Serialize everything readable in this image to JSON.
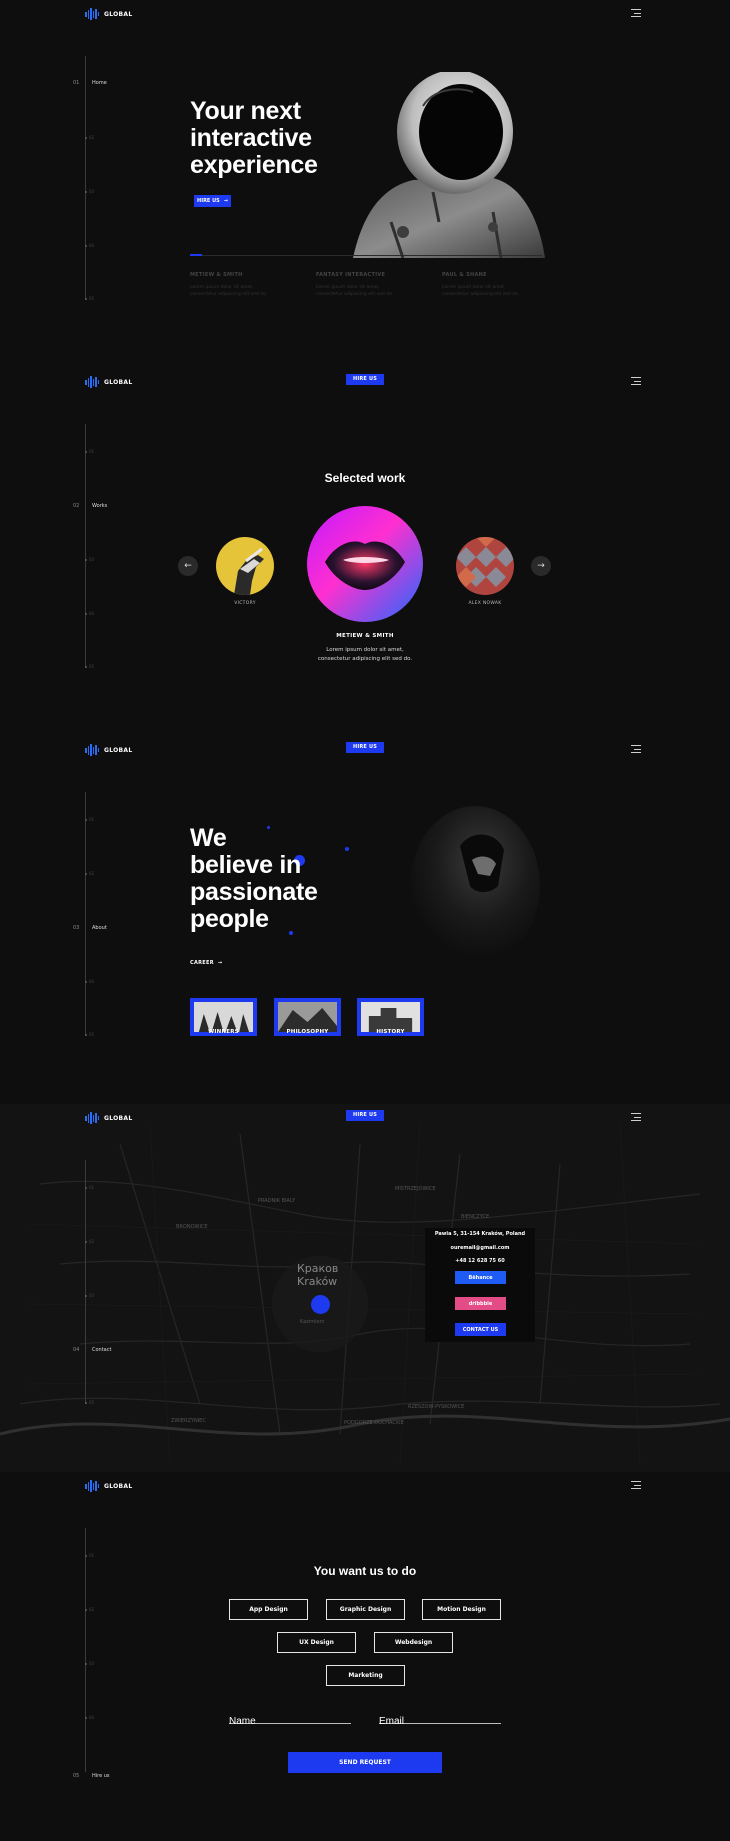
{
  "brand": {
    "logo_text": "GLOBAL",
    "accent": "#1d3af0",
    "logo_color": "#2b6cf6",
    "background": "#0e0e0e"
  },
  "hire_top_label": "HIRE US",
  "sections": {
    "home": {
      "num": "01",
      "label": "Home",
      "muted": [
        "02",
        "03",
        "04",
        "05"
      ]
    },
    "works": {
      "num": "02",
      "label": "Works",
      "muted": [
        "01",
        "03",
        "04",
        "05"
      ]
    },
    "about": {
      "num": "03",
      "label": "About",
      "muted": [
        "01",
        "02",
        "04",
        "05"
      ]
    },
    "contact": {
      "num": "04",
      "label": "Contact",
      "muted": [
        "01",
        "02",
        "03",
        "05"
      ]
    },
    "hire": {
      "num": "05",
      "label": "Hire us",
      "muted": [
        "01",
        "02",
        "03",
        "04"
      ]
    }
  },
  "hero": {
    "title": [
      "Your next",
      "interactive",
      "experience"
    ],
    "button": "HIRE US",
    "clients": [
      {
        "name": "METIEW & SMITH",
        "desc": [
          "Lorem ipsum dolor sit amet,",
          "consectetur adipiscing elit sed do."
        ]
      },
      {
        "name": "FANTASY INTERACTIVE",
        "desc": [
          "Lorem ipsum dolor sit amet,",
          "consectetur adipiscing elit sed do."
        ]
      },
      {
        "name": "PAUL & SHANE",
        "desc": [
          "Lorem ipsum dolor sit amet,",
          "consectetur adipiscing elit sed do."
        ]
      }
    ]
  },
  "works": {
    "title": "Selected work",
    "left_caption": "VICTORY",
    "right_caption": "ALEX NOWAK",
    "main_name": "METIEW & SMITH",
    "main_desc": [
      "Lorem ipsum dolor sit amet,",
      "consectetur adipiscing elit sed do."
    ],
    "prev_icon": "arrow-left-icon",
    "next_icon": "arrow-right-icon"
  },
  "about": {
    "title": [
      "We",
      "believe in",
      "passionate",
      "people"
    ],
    "career": "CAREER",
    "thumbs": [
      "WINNERS",
      "PHILOSOPHY",
      "HISTORY"
    ]
  },
  "contact": {
    "address": "Pawia 5, 31-154 Kraków, Poland",
    "email": "ouremail@gmail.com",
    "phone": "+48 12 628 75 60",
    "behance": "Bēhance",
    "dribbble": "dribbble",
    "contact_us": "CONTACT US",
    "behance_color": "#1f5cf6",
    "dribbble_color": "#e34c86",
    "map_city": [
      "Краков",
      "Kraków"
    ],
    "map_labels": [
      "PRADNIK BIALY",
      "MISTRZEJOWICE",
      "BIENCZYCE",
      "BRONOWICE",
      "PODGORZE DUCHACKIE",
      "RZESZOW-PYSKOWICE",
      "ZWIERZYNIEC",
      "Kazimierz"
    ]
  },
  "hire": {
    "title": "You want us to do",
    "services": [
      "App Design",
      "Graphic Design",
      "Motion Design",
      "UX Design",
      "Webdesign",
      "Marketing"
    ],
    "name_placeholder": "Name",
    "email_placeholder": "Email",
    "send": "SEND REQUEST"
  }
}
